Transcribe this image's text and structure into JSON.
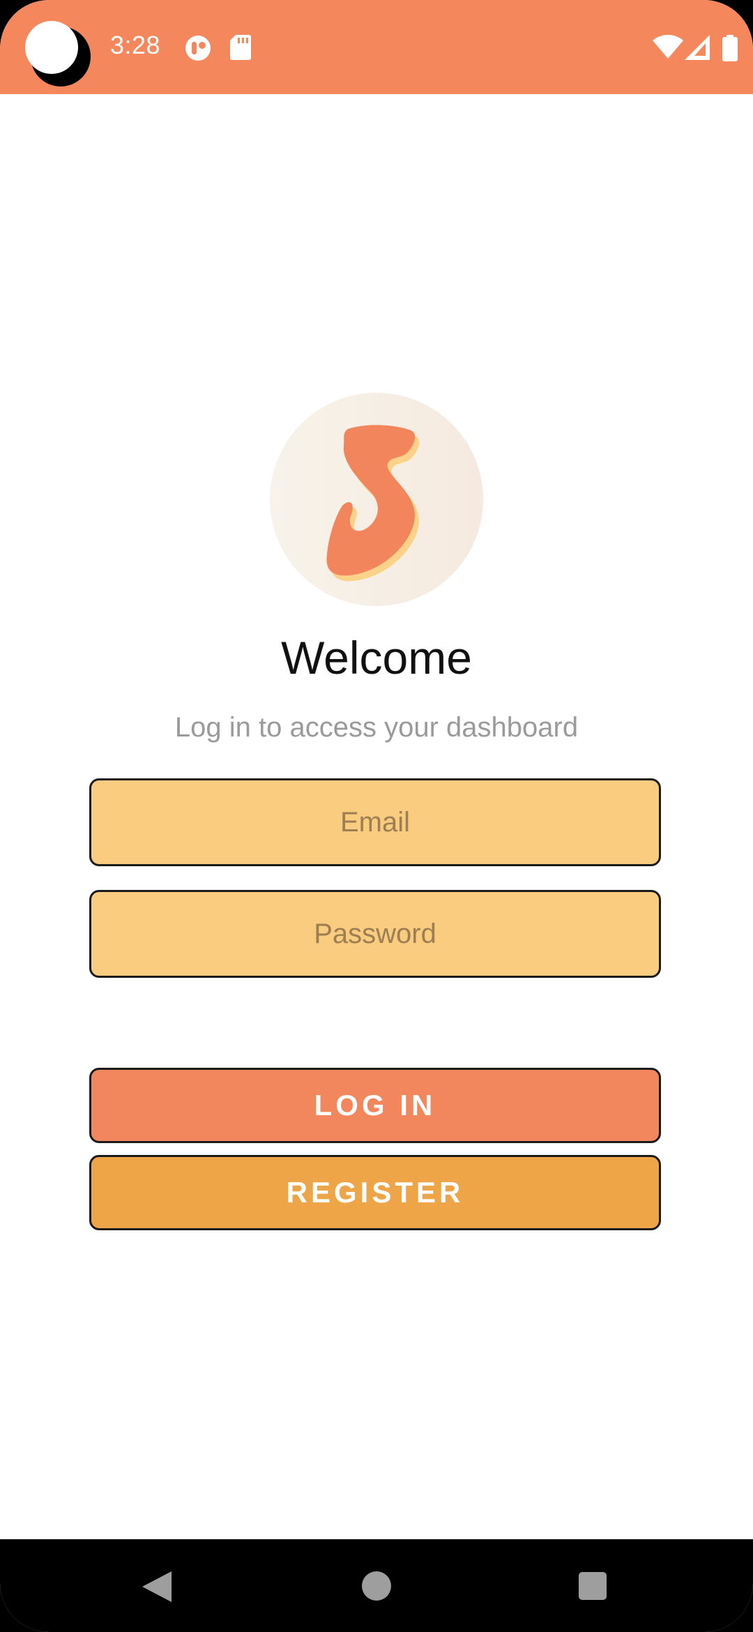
{
  "status_bar": {
    "time": "3:28",
    "background_color": "#F5875C",
    "icons": [
      "notification-app-icon",
      "sd-card-icon",
      "wifi-icon",
      "cell-signal-icon",
      "battery-icon"
    ]
  },
  "logo": {
    "icon": "s-logo-icon",
    "colors": {
      "primary": "#F2855C",
      "shadow": "#FBD28A",
      "background": "#F7F0E6"
    }
  },
  "login": {
    "title": "Welcome",
    "subtitle": "Log in to access your dashboard",
    "email_placeholder": "Email",
    "email_value": "",
    "password_placeholder": "Password",
    "password_value": "",
    "login_label": "LOG IN",
    "register_label": "REGISTER"
  },
  "colors": {
    "input_bg": "#F9CC80",
    "login_button": "#F2875D",
    "register_button": "#EEA548"
  },
  "nav_bar": {
    "icons": [
      "back-icon",
      "home-icon",
      "recents-icon"
    ]
  }
}
